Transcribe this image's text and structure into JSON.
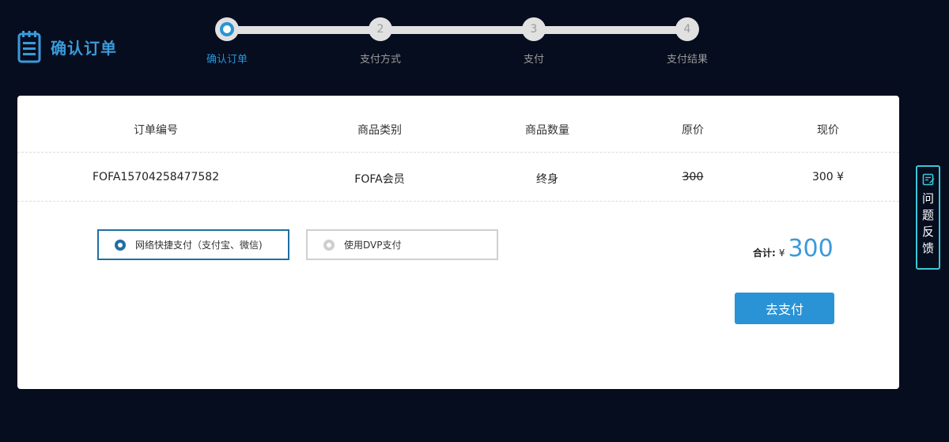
{
  "header": {
    "title": "确认订单",
    "icon": "clipboard-list-icon"
  },
  "steps": [
    {
      "number": "",
      "label": "确认订单",
      "active": true
    },
    {
      "number": "2",
      "label": "支付方式",
      "active": false
    },
    {
      "number": "3",
      "label": "支付",
      "active": false
    },
    {
      "number": "4",
      "label": "支付结果",
      "active": false
    }
  ],
  "table": {
    "headers": [
      "订单编号",
      "商品类别",
      "商品数量",
      "原价",
      "现价"
    ],
    "row": {
      "order_no": "FOFA15704258477582",
      "category": "FOFA会员",
      "quantity": "终身",
      "original_price": "300",
      "current_price": "300 ¥"
    }
  },
  "payment": {
    "option1": "网络快捷支付（支付宝、微信)",
    "option2": "使用DVP支付",
    "selected": "option1"
  },
  "total": {
    "label": "合计:",
    "currency": "¥",
    "amount": "300"
  },
  "pay_button": "去支付",
  "feedback": {
    "text": "问题反馈",
    "icon": "edit-note-icon"
  },
  "colors": {
    "background": "#050d1e",
    "accent": "#2a93d5",
    "feedback_border": "#3cc7d6"
  }
}
